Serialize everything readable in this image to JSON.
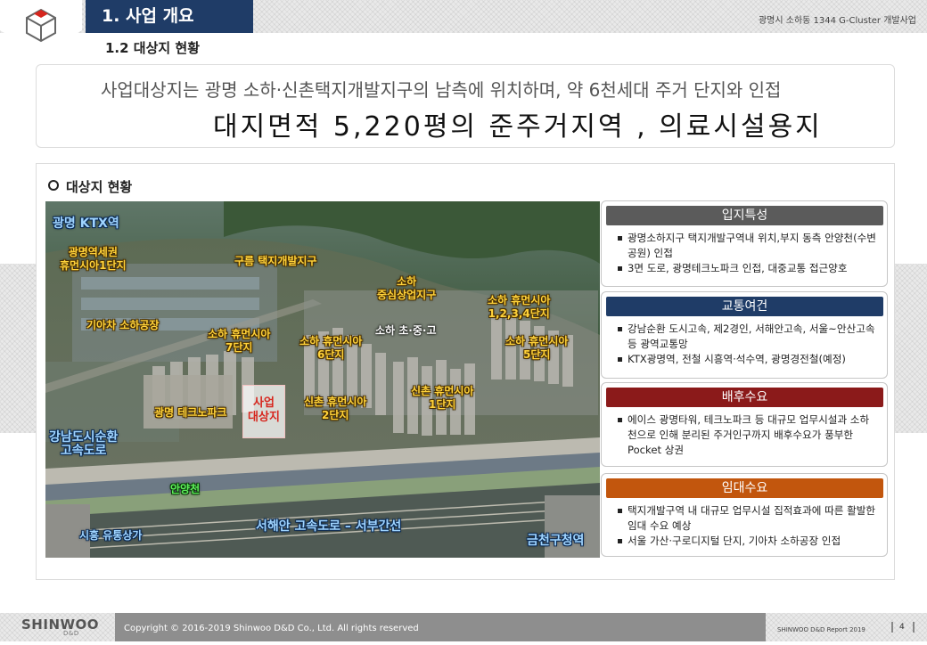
{
  "header": {
    "section_title": "1. 사업 개요",
    "project_name": "광명시 소하동 1344 G-Cluster 개발사업",
    "subsection_title": "1.2 대상지 현황"
  },
  "summary": {
    "line1": "사업대상지는 광명 소하·신촌택지개발지구의 남측에 위치하며, 약 6천세대 주거 단지와 인접",
    "line2": "대지면적 5,220평의 준주거지역 , 의료시설용지"
  },
  "panel": {
    "title": "대상지 현황"
  },
  "map_labels": {
    "ktx": "광명 KTX역",
    "gwangmyeong_station_1": "광명역세권",
    "gwangmyeong_station_2": "휴먼시아1단지",
    "guream": "구름 택지개발지구",
    "kia": "기아차 소하공장",
    "soha_center_1": "소하",
    "soha_center_2": "중심상업지구",
    "soha_1234_1": "소하 휴먼시아",
    "soha_1234_2": "1,2,3,4단지",
    "soha7_1": "소하 휴먼시아",
    "soha7_2": "7단지",
    "soha6_1": "소하 휴먼시아",
    "soha6_2": "6단지",
    "schools": "소하 초·중·고",
    "soha5_1": "소하 휴먼시아",
    "soha5_2": "5단지",
    "techno": "광명 테크노파크",
    "site_1": "사업",
    "site_2": "대상지",
    "sinchon2_1": "신촌 휴먼시아",
    "sinchon2_2": "2단지",
    "sinchon1_1": "신촌 휴먼시아",
    "sinchon1_2": "1단지",
    "gangnam_1": "강남도시순환",
    "gangnam_2": "고속도로",
    "anyang": "안양천",
    "west_coast": "서해안 고속도로 – 서부간선",
    "siheung": "시흥 유통상가",
    "geumcheon": "금천구청역"
  },
  "cards": [
    {
      "title": "입지특성",
      "color": "#5b5b5b",
      "items": [
        "광명소하지구 택지개발구역내 위치,부지 동측 안양천(수변공원) 인접",
        "3면 도로, 광명테크노파크 인접, 대중교통 접근양호"
      ]
    },
    {
      "title": "교통여건",
      "color": "#1f3c67",
      "items": [
        "강남순환 도시고속, 제2경인, 서해안고속, 서울~안산고속 등 광역교통망",
        "KTX광명역, 전철 시흥역·석수역, 광명경전철(예정)"
      ]
    },
    {
      "title": "배후수요",
      "color": "#8b1a1a",
      "items": [
        "에이스 광명타워, 테크노파크 등 대규모 업무시설과 소하천으로 인해 분리된 주거인구까지 배후수요가 풍부한 Pocket 상권"
      ]
    },
    {
      "title": "임대수요",
      "color": "#c2560d",
      "items": [
        "택지개발구역 내 대규모 업무시설 집적효과에 따른 활발한 임대 수요 예상",
        "서울 가산·구로디지털 단지, 기아차 소하공장 인접"
      ]
    }
  ],
  "footer": {
    "logo": "SHINWOO",
    "logo_sub": "D&D",
    "copyright": "Copyright © 2016-2019 Shinwoo D&D Co., Ltd.  All rights reserved",
    "report": "SHINWOO D&D Report 2019",
    "page": "4"
  }
}
